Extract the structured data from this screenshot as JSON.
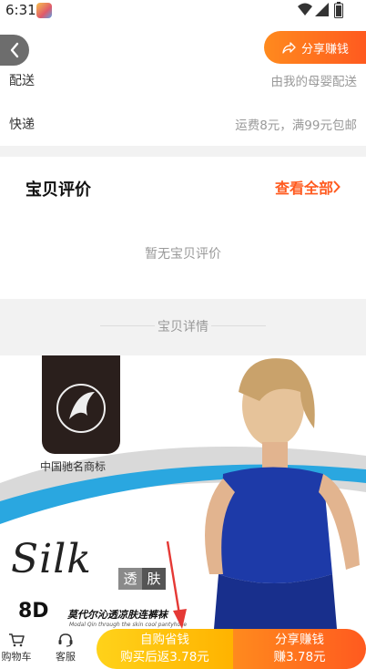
{
  "status_bar": {
    "time": "6:31"
  },
  "header": {
    "share_label": "分享赚钱"
  },
  "info_rows": [
    {
      "label": "配送",
      "value": "由我的母婴配送"
    },
    {
      "label": "快递",
      "value": "运费8元，满99元包邮"
    }
  ],
  "reviews": {
    "title": "宝贝评价",
    "view_all": "查看全部",
    "empty_text": "暂无宝贝评价"
  },
  "details": {
    "title": "宝贝详情"
  },
  "product_image": {
    "trademark": "中国驰名商标",
    "brand_script": "Silk",
    "tag_left": "透",
    "tag_right": "肤",
    "model": "8D",
    "slogan": "莫代尔沁透凉肤连裤袜",
    "slogan_en": "Modal Qin through the skin cool pantyhose"
  },
  "bottom_bar": {
    "cart_label": "购物车",
    "service_label": "客服",
    "buy_line1": "自购省钱",
    "buy_line2": "购买后返3.78元",
    "share_line1": "分享赚钱",
    "share_line2": "赚3.78元"
  },
  "colors": {
    "accent": "#ff5a1f",
    "buy": "#ffc107"
  },
  "icons": [
    "back-icon",
    "share-icon",
    "chevron-right-icon",
    "cart-icon",
    "headset-icon",
    "wifi-icon",
    "signal-icon",
    "battery-icon"
  ]
}
